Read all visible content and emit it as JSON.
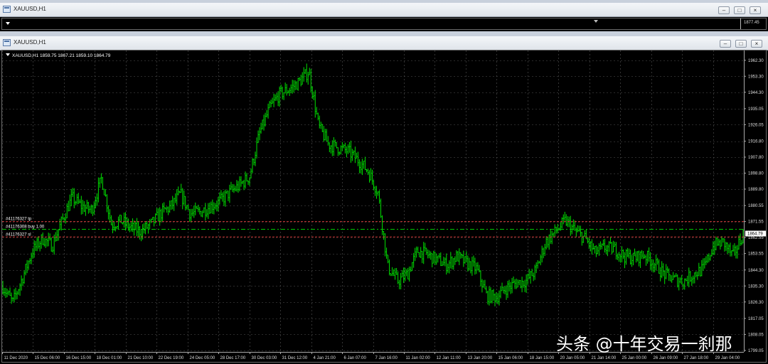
{
  "window_top": {
    "title": "XAUUSD,H1",
    "price_label": "1877.45",
    "buttons": {
      "minimize": "–",
      "maximize": "□",
      "close": "×"
    }
  },
  "window_main": {
    "title": "XAUUSD,H1",
    "info_line": "XAUUSD,H1  1859.75 1867.21 1859.10 1864.79",
    "buttons": {
      "minimize": "–",
      "maximize": "□",
      "close": "×"
    }
  },
  "colors": {
    "background": "#000000",
    "candles": "#00e000",
    "grid": "#555555",
    "order_line": "#00cc00",
    "tp_sl_line": "#cc3333",
    "text": "#ffffff"
  },
  "orders": {
    "tp_label": "#41176327 tp",
    "buy_label": "#41176308 buy 1.00",
    "sl_label": "#41176327 sl",
    "tp_price": 1871.55,
    "buy_price": 1867.2,
    "sl_price": 1862.9
  },
  "current_price_tag": "1864.79",
  "chart_data": {
    "type": "line",
    "symbol": "XAUUSD",
    "timeframe": "H1",
    "ylim": [
      1799,
      1967
    ],
    "y_ticks": [
      "1962.30",
      "1953.30",
      "1944.30",
      "1935.05",
      "1926.05",
      "1916.80",
      "1907.80",
      "1898.80",
      "1889.80",
      "1880.55",
      "1871.55",
      "1862.55",
      "1853.55",
      "1844.30",
      "1835.30",
      "1826.30",
      "1817.05",
      "1808.05",
      "1799.05"
    ],
    "x_labels": [
      "11 Dec 2020",
      "15 Dec 06:00",
      "16 Dec 15:00",
      "18 Dec 01:00",
      "21 Dec 10:00",
      "22 Dec 19:00",
      "24 Dec 05:00",
      "28 Dec 17:00",
      "30 Dec 03:00",
      "31 Dec 12:00",
      "4 Jan 21:00",
      "6 Jan 07:00",
      "7 Jan 16:00",
      "11 Jan 02:00",
      "12 Jan 11:00",
      "13 Jan 20:00",
      "15 Jan 06:00",
      "18 Jan 15:00",
      "20 Jan 05:00",
      "21 Jan 14:00",
      "25 Jan 00:00",
      "26 Jan 09:00",
      "27 Jan 18:00",
      "29 Jan 04:00"
    ],
    "series": [
      {
        "values": [
          {
            "x": "11 Dec 2020",
            "y": 1835
          },
          {
            "x": "14 Dec",
            "y": 1826
          },
          {
            "x": "15 Dec 06:00",
            "y": 1840
          },
          {
            "x": "15 Dec 18:00",
            "y": 1855
          },
          {
            "x": "16 Dec 06:00",
            "y": 1862
          },
          {
            "x": "16 Dec 15:00",
            "y": 1858
          },
          {
            "x": "17 Dec 00:00",
            "y": 1872
          },
          {
            "x": "17 Dec 12:00",
            "y": 1885
          },
          {
            "x": "18 Dec 01:00",
            "y": 1880
          },
          {
            "x": "18 Dec 12:00",
            "y": 1878
          },
          {
            "x": "20 Dec 20:00",
            "y": 1896
          },
          {
            "x": "21 Dec 10:00",
            "y": 1870
          },
          {
            "x": "22 Dec 00:00",
            "y": 1872
          },
          {
            "x": "22 Dec 12:00",
            "y": 1868
          },
          {
            "x": "22 Dec 19:00",
            "y": 1866
          },
          {
            "x": "23 Dec 06:00",
            "y": 1870
          },
          {
            "x": "24 Dec 05:00",
            "y": 1876
          },
          {
            "x": "24 Dec 20:00",
            "y": 1880
          },
          {
            "x": "27 Dec 23:00",
            "y": 1887
          },
          {
            "x": "28 Dec 17:00",
            "y": 1876
          },
          {
            "x": "29 Dec 10:00",
            "y": 1877
          },
          {
            "x": "30 Dec 03:00",
            "y": 1880
          },
          {
            "x": "30 Dec 15:00",
            "y": 1883
          },
          {
            "x": "31 Dec 01:00",
            "y": 1888
          },
          {
            "x": "31 Dec 12:00",
            "y": 1892
          },
          {
            "x": "31 Dec 20:00",
            "y": 1897
          },
          {
            "x": "4 Jan 04:00",
            "y": 1921
          },
          {
            "x": "4 Jan 12:00",
            "y": 1935
          },
          {
            "x": "4 Jan 21:00",
            "y": 1943
          },
          {
            "x": "5 Jan 10:00",
            "y": 1946
          },
          {
            "x": "5 Jan 22:00",
            "y": 1950
          },
          {
            "x": "6 Jan 07:00",
            "y": 1956
          },
          {
            "x": "6 Jan 12:00",
            "y": 1925
          },
          {
            "x": "6 Jan 18:00",
            "y": 1915
          },
          {
            "x": "7 Jan 03:00",
            "y": 1913
          },
          {
            "x": "7 Jan 12:00",
            "y": 1911
          },
          {
            "x": "7 Jan 16:00",
            "y": 1906
          },
          {
            "x": "7 Jan 22:00",
            "y": 1900
          },
          {
            "x": "8 Jan 08:00",
            "y": 1888
          },
          {
            "x": "8 Jan 14:00",
            "y": 1846
          },
          {
            "x": "8 Jan 20:00",
            "y": 1838
          },
          {
            "x": "11 Jan 02:00",
            "y": 1842
          },
          {
            "x": "11 Jan 15:00",
            "y": 1855
          },
          {
            "x": "12 Jan 00:00",
            "y": 1853
          },
          {
            "x": "12 Jan 11:00",
            "y": 1850
          },
          {
            "x": "12 Jan 22:00",
            "y": 1847
          },
          {
            "x": "13 Jan 10:00",
            "y": 1852
          },
          {
            "x": "13 Jan 20:00",
            "y": 1848
          },
          {
            "x": "14 Jan 08:00",
            "y": 1845
          },
          {
            "x": "14 Jan 20:00",
            "y": 1830
          },
          {
            "x": "15 Jan 06:00",
            "y": 1829
          },
          {
            "x": "15 Jan 18:00",
            "y": 1834
          },
          {
            "x": "18 Jan 03:00",
            "y": 1837
          },
          {
            "x": "18 Jan 15:00",
            "y": 1838
          },
          {
            "x": "19 Jan 06:00",
            "y": 1844
          },
          {
            "x": "19 Jan 18:00",
            "y": 1860
          },
          {
            "x": "20 Jan 05:00",
            "y": 1866
          },
          {
            "x": "20 Jan 16:00",
            "y": 1872
          },
          {
            "x": "21 Jan 04:00",
            "y": 1866
          },
          {
            "x": "21 Jan 14:00",
            "y": 1862
          },
          {
            "x": "22 Jan 02:00",
            "y": 1854
          },
          {
            "x": "22 Jan 14:00",
            "y": 1857
          },
          {
            "x": "25 Jan 00:00",
            "y": 1856
          },
          {
            "x": "25 Jan 12:00",
            "y": 1852
          },
          {
            "x": "26 Jan 00:00",
            "y": 1851
          },
          {
            "x": "26 Jan 09:00",
            "y": 1853
          },
          {
            "x": "26 Jan 20:00",
            "y": 1848
          },
          {
            "x": "27 Jan 08:00",
            "y": 1842
          },
          {
            "x": "27 Jan 18:00",
            "y": 1839
          },
          {
            "x": "28 Jan 06:00",
            "y": 1838
          },
          {
            "x": "28 Jan 16:00",
            "y": 1842
          },
          {
            "x": "28 Jan 22:00",
            "y": 1845
          },
          {
            "x": "29 Jan 04:00",
            "y": 1858
          },
          {
            "x": "29 Jan 10:00",
            "y": 1860
          },
          {
            "x": "29 Jan 16:00",
            "y": 1852
          },
          {
            "x": "29 Jan 22:00",
            "y": 1864.79
          }
        ]
      }
    ],
    "grid": true
  },
  "watermark": "头条 @十年交易一刹那"
}
